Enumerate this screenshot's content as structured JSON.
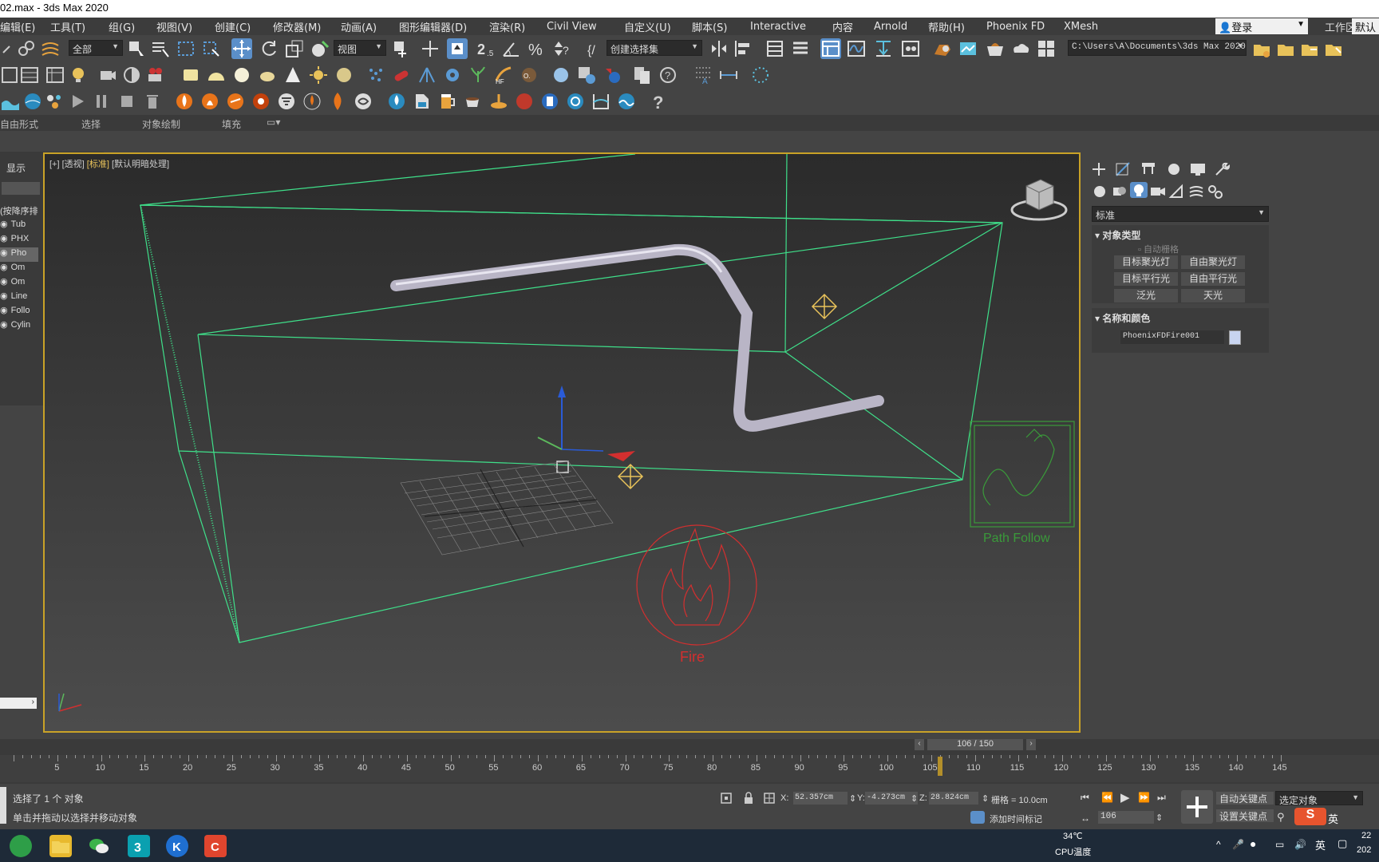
{
  "window": {
    "title": "02.max - 3ds Max 2020"
  },
  "menu": [
    "编辑(E)",
    "工具(T)",
    "组(G)",
    "视图(V)",
    "创建(C)",
    "修改器(M)",
    "动画(A)",
    "图形编辑器(D)",
    "渲染(R)",
    "Civil View",
    "自定义(U)",
    "脚本(S)",
    "Interactive",
    "内容",
    "Arnold",
    "帮助(H)",
    "Phoenix FD",
    "XMesh"
  ],
  "account": {
    "login_label": "登录",
    "workspace_label": "工作区:",
    "workspace_value": "默认"
  },
  "toolbar": {
    "filter_value": "全部",
    "refcoord_value": "视图",
    "named_selection_placeholder": "创建选择集",
    "project_path": "C:\\Users\\A\\Documents\\3ds Max 2020",
    "snap_value": "2.5"
  },
  "ribbon": {
    "tabs": [
      "自由形式",
      "选择",
      "对象绘制",
      "填充"
    ]
  },
  "scene_explorer": {
    "display_label": "显示",
    "sort_label": "(按降序排",
    "items": [
      "Tub",
      "PHX",
      "Pho",
      "Om",
      "Om",
      "Line",
      "Follo",
      "Cylin"
    ]
  },
  "viewport": {
    "label_plus": "[+]",
    "label_view": "[透视]",
    "label_shading": "[标准]",
    "label_lighting": "[默认明暗处理]",
    "fire_label": "Fire",
    "path_follow_label": "Path Follow"
  },
  "command_panel": {
    "category_value": "标准",
    "object_type_title": "对象类型",
    "autogrid_label": "自动栅格",
    "buttons": [
      "目标聚光灯",
      "自由聚光灯",
      "目标平行光",
      "自由平行光",
      "泛光",
      "天光"
    ],
    "name_color_title": "名称和颜色",
    "object_name": "PhoenixFDFire001",
    "object_color": "#c8d4f0"
  },
  "timeline": {
    "frame_display": "106 / 150",
    "ticks": [
      "5",
      "10",
      "15",
      "20",
      "25",
      "30",
      "35",
      "40",
      "45",
      "50",
      "55",
      "60",
      "65",
      "70",
      "75",
      "80",
      "85",
      "90",
      "95",
      "100",
      "105",
      "110",
      "115",
      "120",
      "125",
      "130",
      "135",
      "140",
      "145"
    ],
    "current_frame": 106,
    "total_frames": 150
  },
  "status": {
    "selection_text": "选择了 1 个 对象",
    "prompt_text": "单击并拖动以选择并移动对象",
    "x_label": "X:",
    "x_value": "52.357cm",
    "y_label": "Y:",
    "y_value": "-4.273cm",
    "z_label": "Z:",
    "z_value": "28.824cm",
    "grid_text": "栅格 = 10.0cm",
    "add_time_tag": "添加时间标记",
    "auto_key": "自动关键点",
    "set_key": "设置关键点",
    "selected_object": "选定对象",
    "frame_spinner": "106"
  },
  "taskbar": {
    "temp": "34℃",
    "temp_label": "CPU温度",
    "ime": "英",
    "time_partial": "22",
    "date_partial": "202",
    "sogou": "英"
  }
}
